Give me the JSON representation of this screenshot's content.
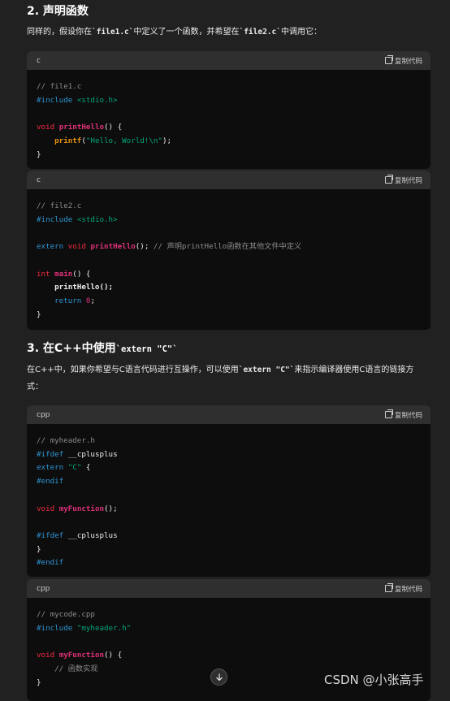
{
  "section2": {
    "heading": "2. 声明函数",
    "para_a": "同样的，假设你在",
    "para_code1": "`file1.c`",
    "para_b": "中定义了一个函数，并希望在",
    "para_code2": "`file2.c`",
    "para_c": "中调用它："
  },
  "section3": {
    "heading_a": "3. 在C++中使用",
    "heading_code": "`extern \"C\"`",
    "para_a": "在C++中，如果你希望与C语言代码进行互操作，可以使用",
    "para_code": "`extern \"C\"`",
    "para_b": "来指示编译器使用C语言的链接方式："
  },
  "copy_label": "复制代码",
  "blocks": [
    {
      "lang": "c",
      "lines": [
        "// file1.c",
        "#include",
        "<stdio.h>",
        "void",
        "printHello",
        "() {",
        "printf",
        "(",
        "\"Hello, World!\\n\"",
        ");",
        "}"
      ]
    },
    {
      "lang": "c",
      "lines": [
        "// file2.c",
        "#include",
        "<stdio.h>",
        "extern",
        "void",
        "printHello",
        "(); ",
        "// 声明printHello函数在其他文件中定义",
        "int",
        "main",
        "() {",
        "printHello();",
        "return",
        "0",
        ";",
        "}"
      ]
    },
    {
      "lang": "cpp",
      "lines": [
        "// myheader.h",
        "#ifdef",
        "__cplusplus",
        "extern",
        "\"C\"",
        " {",
        "#endif",
        "void",
        "myFunction",
        "();",
        "#ifdef",
        "__cplusplus",
        "}",
        "#endif"
      ]
    },
    {
      "lang": "cpp",
      "lines": [
        "// mycode.cpp",
        "#include",
        "\"myheader.h\"",
        "void",
        "myFunction",
        "() {",
        "// 函数实现",
        "}"
      ]
    }
  ],
  "scroll_icon": "arrow-down-icon",
  "watermark": "CSDN @小张高手"
}
